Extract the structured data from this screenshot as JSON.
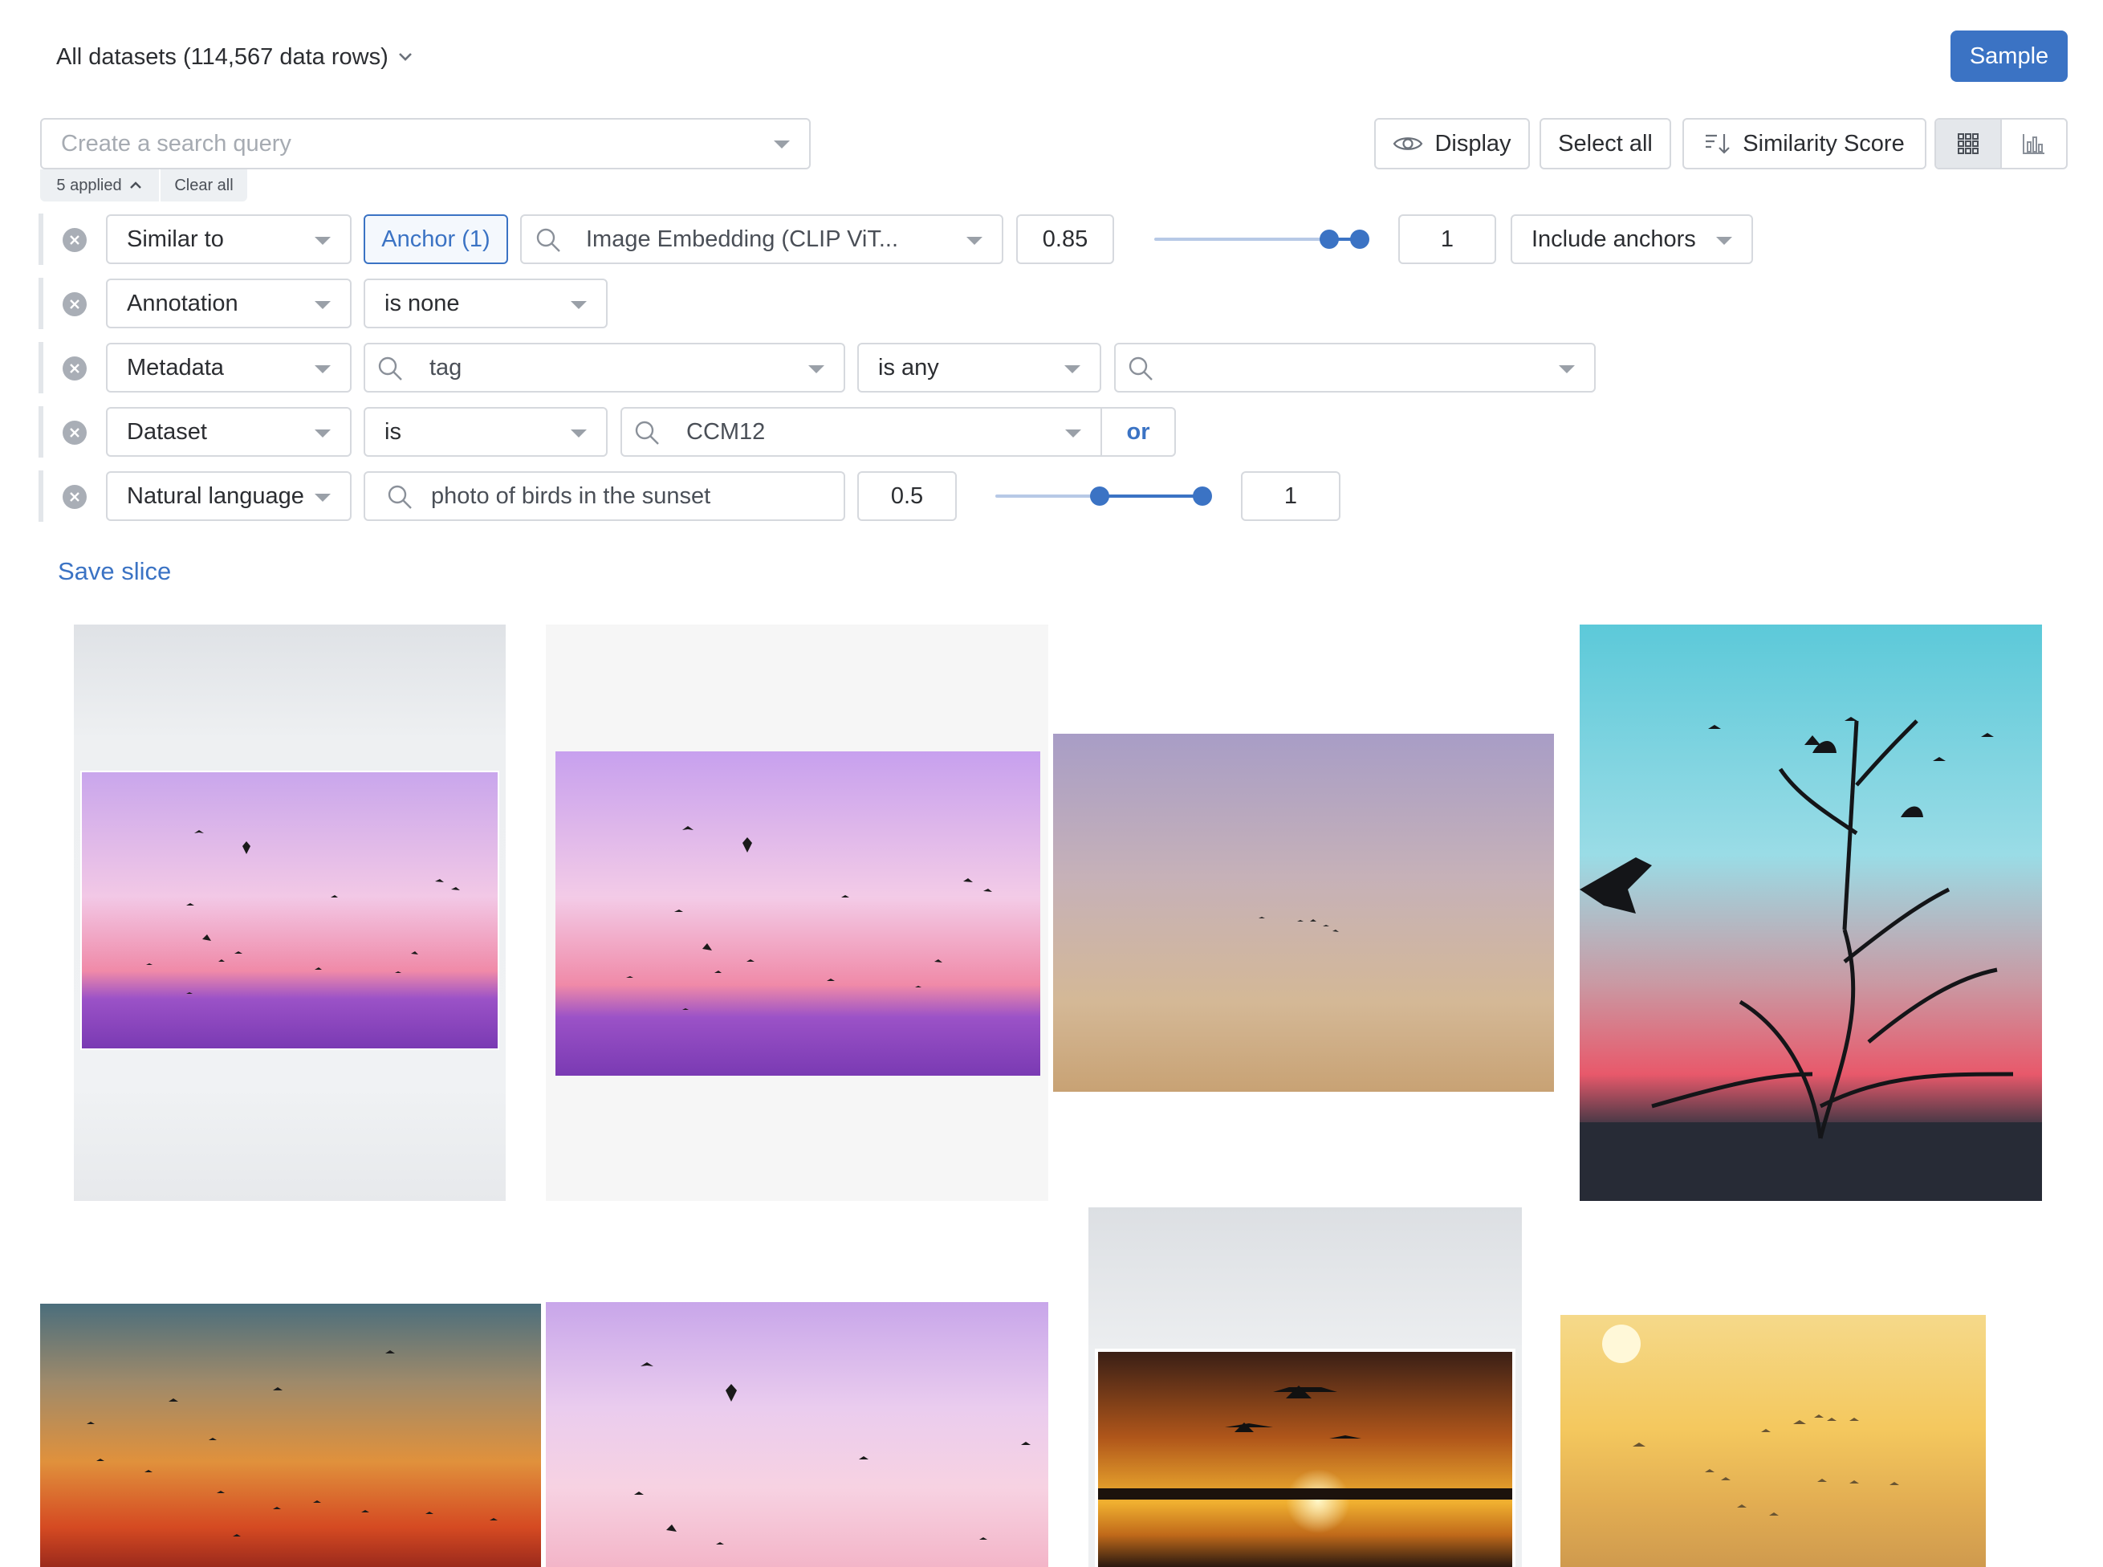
{
  "header": {
    "dataset_label": "All datasets (114,567 data rows)",
    "sample_button": "Sample"
  },
  "search": {
    "placeholder": "Create a search query",
    "applied_label": "5 applied",
    "clear_all": "Clear all"
  },
  "toolbar": {
    "display": "Display",
    "select_all": "Select all",
    "sort_label": "Similarity Score"
  },
  "filters": {
    "row1": {
      "field": "Similar to",
      "anchor": "Anchor (1)",
      "embedding": "Image Embedding (CLIP ViT...",
      "min": "0.85",
      "max": "1",
      "anchors_option": "Include anchors"
    },
    "row2": {
      "field": "Annotation",
      "operator": "is none"
    },
    "row3": {
      "field": "Metadata",
      "key": "tag",
      "operator": "is any",
      "value": ""
    },
    "row4": {
      "field": "Dataset",
      "operator": "is",
      "value": "CCM12",
      "or_button": "or"
    },
    "row5": {
      "field": "Natural language",
      "query": "photo of birds in the sunset",
      "min": "0.5",
      "max": "1"
    }
  },
  "save_slice": "Save slice",
  "colors": {
    "accent": "#3b73c4",
    "border": "#d6d9de"
  }
}
